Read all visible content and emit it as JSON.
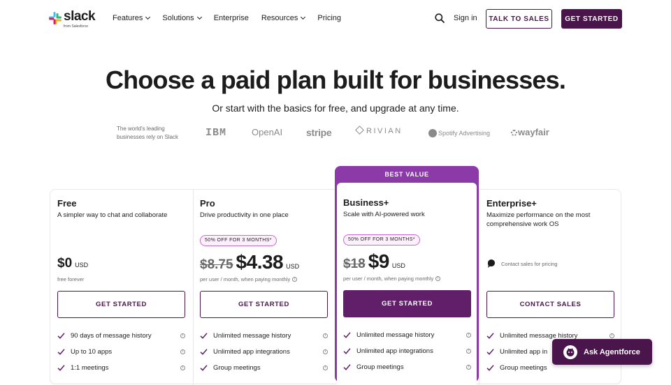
{
  "nav": {
    "logo_word": "slack",
    "logo_sub": "from Salesforce",
    "menu": [
      {
        "label": "Features",
        "has_dropdown": true
      },
      {
        "label": "Solutions",
        "has_dropdown": true
      },
      {
        "label": "Enterprise",
        "has_dropdown": false
      },
      {
        "label": "Resources",
        "has_dropdown": true
      },
      {
        "label": "Pricing",
        "has_dropdown": false
      }
    ],
    "signin": "Sign in",
    "talk_to_sales": "TALK TO SALES",
    "get_started": "GET STARTED",
    "search_icon": "search-icon"
  },
  "hero": {
    "title": "Choose a paid plan built for businesses.",
    "subtitle": "Or start with the basics for free, and upgrade at any time."
  },
  "trust": {
    "text": "The world's leading businesses rely on Slack",
    "brands": [
      "IBM",
      "OpenAI",
      "stripe",
      "RIVIAN",
      "Spotify Advertising",
      "wayfair"
    ]
  },
  "plans": [
    {
      "name": "Free",
      "desc": "A simpler way to chat and collaborate",
      "price": "$0",
      "currency": "USD",
      "note": "free forever",
      "cta": "GET STARTED",
      "features": [
        "90 days of message history",
        "Up to 10 apps",
        "1:1 meetings"
      ]
    },
    {
      "name": "Pro",
      "desc": "Drive productivity in one place",
      "promo": "50% OFF FOR 3 MONTHS*",
      "old_price": "$8.75",
      "price": "$4.38",
      "currency": "USD",
      "note": "per user / month, when paying monthly",
      "cta": "GET STARTED",
      "features": [
        "Unlimited message history",
        "Unlimited app integrations",
        "Group meetings"
      ]
    },
    {
      "badge": "BEST VALUE",
      "name": "Business+",
      "desc": "Scale with AI-powered work",
      "promo": "50% OFF FOR 3 MONTHS*",
      "old_price": "$18",
      "price": "$9",
      "currency": "USD",
      "note": "per user / month, when paying monthly",
      "cta": "GET STARTED",
      "features": [
        "Unlimited message history",
        "Unlimited app integrations",
        "Group meetings"
      ]
    },
    {
      "name": "Enterprise+",
      "desc": "Maximize performance on the most comprehensive work OS",
      "contact_note": "Contact sales for pricing",
      "cta": "CONTACT SALES",
      "features": [
        "Unlimited message history",
        "Unlimited app in",
        "Group meetings"
      ]
    }
  ],
  "agent": {
    "label": "Ask Agentforce"
  },
  "colors": {
    "brand": "#4a154b",
    "featured": "#8b3aa8",
    "check": "#611f69"
  }
}
